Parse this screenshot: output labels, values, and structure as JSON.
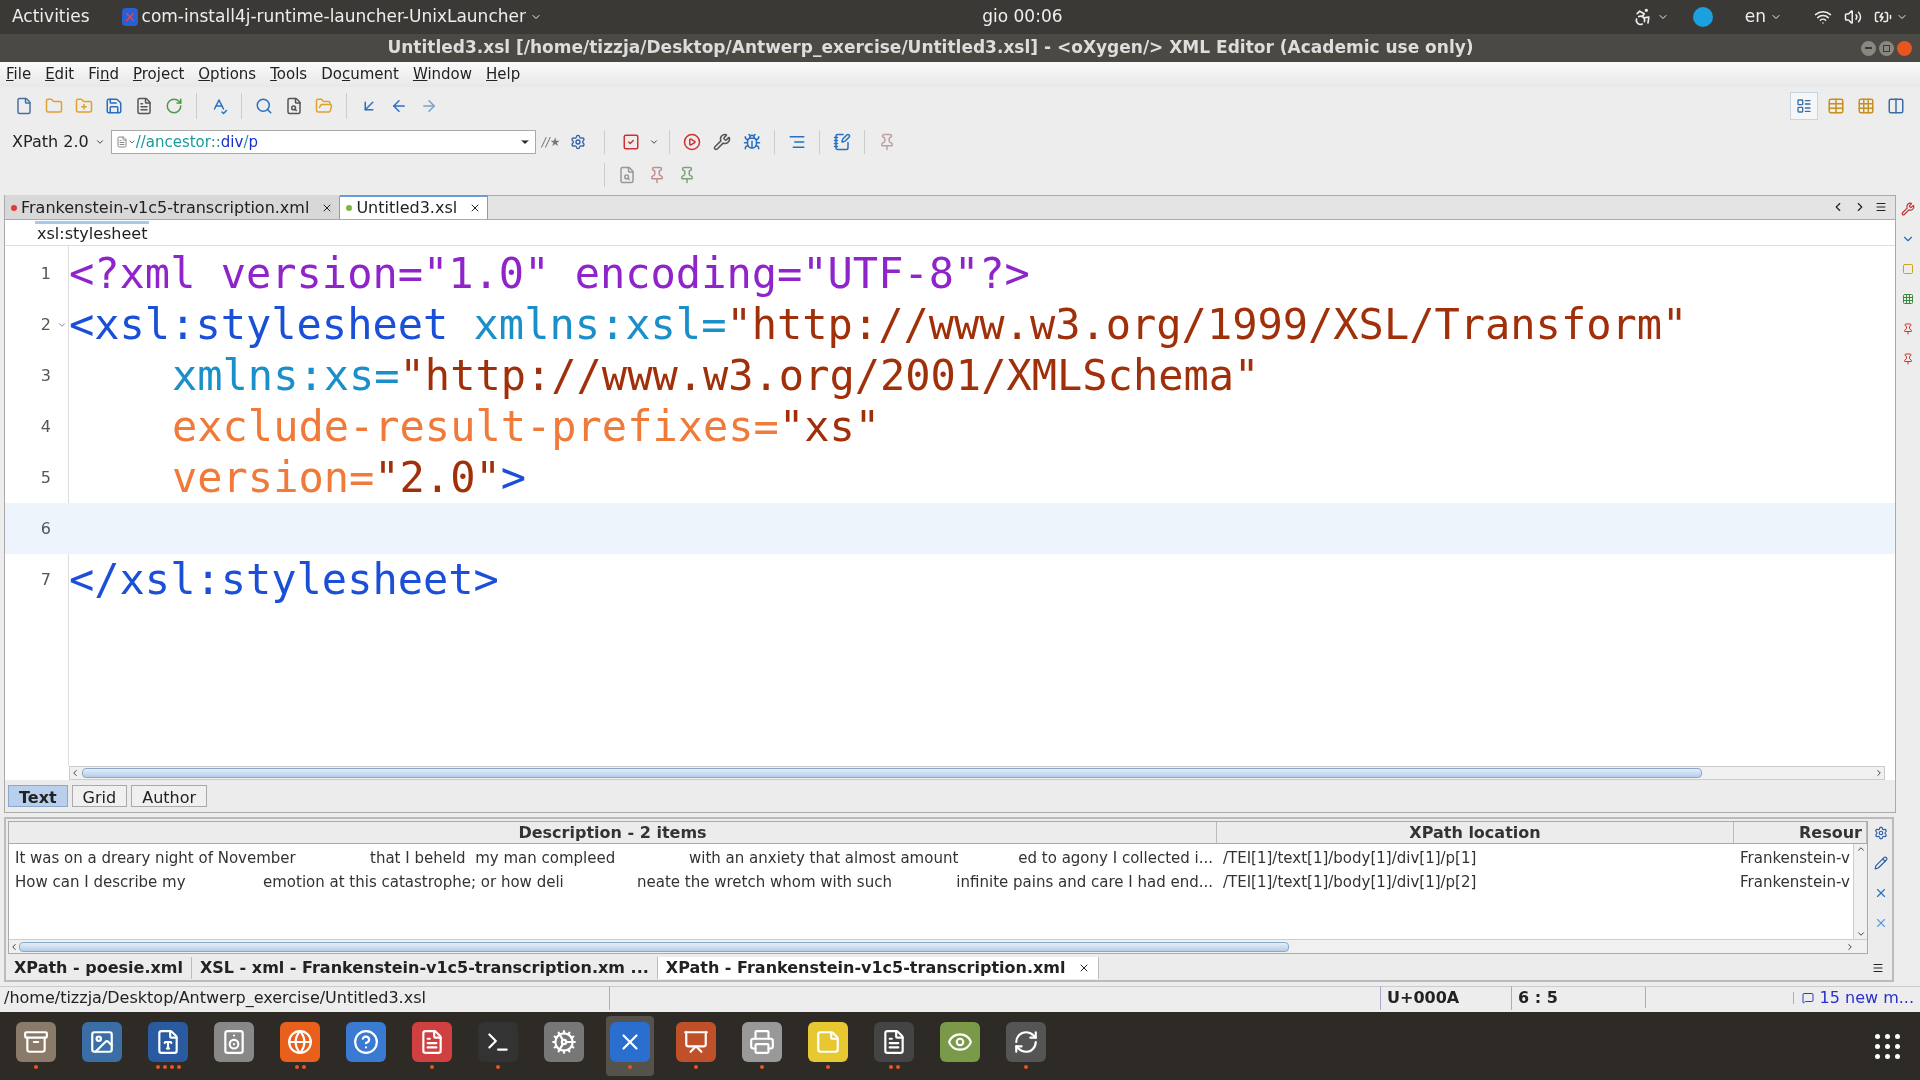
{
  "top_bar": {
    "activities": "Activities",
    "app_name": "com-install4j-runtime-launcher-UnixLauncher",
    "clock": "gio 00:06",
    "language": "en"
  },
  "window": {
    "title": "Untitled3.xsl [/home/tizzja/Desktop/Antwerp_exercise/Untitled3.xsl] - <oXygen/> XML Editor (Academic use only)"
  },
  "menu": [
    {
      "key": "F",
      "rest": "ile"
    },
    {
      "key": "E",
      "rest": "dit"
    },
    {
      "before": "Fi",
      "key": "n",
      "rest": "d"
    },
    {
      "key": "P",
      "rest": "roject"
    },
    {
      "key": "O",
      "rest": "ptions"
    },
    {
      "key": "T",
      "rest": "ools"
    },
    {
      "before": "Do",
      "key": "c",
      "rest": "ument"
    },
    {
      "key": "W",
      "rest": "indow"
    },
    {
      "key": "H",
      "rest": "elp"
    }
  ],
  "xpath_bar": {
    "version": "XPath 2.0",
    "regex_toggle": "//★",
    "query_parts": [
      {
        "text": "//ancestor::",
        "kind": "axis"
      },
      {
        "text": "div",
        "kind": "name"
      },
      {
        "text": "/",
        "kind": "axis"
      },
      {
        "text": "p",
        "kind": "name"
      }
    ]
  },
  "editor_tabs": [
    {
      "label": "Frankenstein-v1c5-transcription.xml",
      "color": "#e53935",
      "selected": false
    },
    {
      "label": "Untitled3.xsl",
      "color": "#7cb342",
      "selected": true
    }
  ],
  "breadcrumb": "xsl:stylesheet",
  "code_lines": [
    {
      "number": "1",
      "indent": false,
      "current": false,
      "foldable": false,
      "tokens": [
        {
          "text": "<?xml version=\"1.0\" encoding=\"UTF-8\"?>",
          "kind": "pi"
        }
      ]
    },
    {
      "number": "2",
      "indent": false,
      "current": false,
      "foldable": true,
      "tokens": [
        {
          "text": "<xsl:stylesheet ",
          "kind": "tag"
        },
        {
          "text": "xmlns:xsl=",
          "kind": "ns"
        },
        {
          "text": "\"http://www.w3.org/1999/XSL/Transform\"",
          "kind": "value"
        }
      ]
    },
    {
      "number": "3",
      "indent": true,
      "current": false,
      "foldable": false,
      "tokens": [
        {
          "text": "xmlns:xs=",
          "kind": "ns"
        },
        {
          "text": "\"http://www.w3.org/2001/XMLSchema\"",
          "kind": "value"
        }
      ]
    },
    {
      "number": "4",
      "indent": true,
      "current": false,
      "foldable": false,
      "tokens": [
        {
          "text": "exclude-result-prefixes=",
          "kind": "attr"
        },
        {
          "text": "\"xs\"",
          "kind": "value"
        }
      ]
    },
    {
      "number": "5",
      "indent": true,
      "current": false,
      "foldable": false,
      "tokens": [
        {
          "text": "version=",
          "kind": "attr"
        },
        {
          "text": "\"2.0\"",
          "kind": "value"
        },
        {
          "text": ">",
          "kind": "tag"
        }
      ]
    },
    {
      "number": "6",
      "current": true,
      "foldable": false
    },
    {
      "number": "7",
      "indent": false,
      "current": false,
      "foldable": false,
      "tokens": [
        {
          "text": "</xsl:stylesheet>",
          "kind": "tag"
        }
      ]
    }
  ],
  "mode_tabs": [
    {
      "label": "Text",
      "selected": true
    },
    {
      "label": "Grid",
      "selected": false
    },
    {
      "label": "Author",
      "selected": false
    }
  ],
  "results": {
    "columns": [
      "Description - 2 items",
      "XPath location",
      "Resour"
    ],
    "rows": [
      {
        "description_parts": [
          "It was on a dreary night of November",
          "that I beheld  my man compleed",
          "with an anxiety that almost amount",
          "ed to agony I collected i..."
        ],
        "location": "/TEI[1]/text[1]/body[1]/div[1]/p[1]",
        "resource": "Frankenstein-v"
      },
      {
        "description_parts": [
          "How can I describe my",
          "emotion at this catastrophe; or how deli",
          "neate the wretch whom with such",
          "infinite pains and care I had end..."
        ],
        "location": "/TEI[1]/text[1]/body[1]/div[1]/p[2]",
        "resource": "Frankenstein-v"
      }
    ]
  },
  "result_tabs": [
    {
      "label": "XPath - poesie.xml",
      "selected": false,
      "closable": false
    },
    {
      "label": "XSL - xml - Frankenstein-v1c5-transcription.xm ...",
      "selected": false,
      "closable": false
    },
    {
      "label": "XPath - Frankenstein-v1c5-transcription.xml",
      "selected": true,
      "closable": true
    }
  ],
  "status_bar": {
    "path": "/home/tizzja/Desktop/Antwerp_exercise/Untitled3.xsl",
    "char": "U+000A",
    "position": "6 : 5",
    "messages": "15 new m..."
  },
  "dock": [
    {
      "kind": "files",
      "running_windows": [
        {
          "kind": "dot"
        }
      ],
      "active": false
    },
    {
      "kind": "photos",
      "active": false
    },
    {
      "kind": "writer",
      "running_windows": [
        {
          "kind": "dot"
        },
        {
          "kind": "dot"
        },
        {
          "kind": "dot"
        },
        {
          "kind": "dot"
        }
      ],
      "active": false
    },
    {
      "kind": "speaker",
      "active": false
    },
    {
      "kind": "browser",
      "running_windows": [
        {
          "kind": "dot"
        },
        {
          "kind": "dot"
        }
      ],
      "active": false
    },
    {
      "kind": "help",
      "active": false
    },
    {
      "kind": "pdf",
      "running_windows": [
        {
          "kind": "dot"
        }
      ],
      "active": false
    },
    {
      "kind": "terminal",
      "running_windows": [
        {
          "kind": "dot"
        }
      ],
      "active": false
    },
    {
      "kind": "settings",
      "active": false
    },
    {
      "kind": "oxygen",
      "running_windows": [
        {
          "kind": "dot"
        }
      ],
      "active": true
    },
    {
      "kind": "impress",
      "running_windows": [
        {
          "kind": "dot"
        }
      ],
      "active": false
    },
    {
      "kind": "scanner",
      "running_windows": [
        {
          "kind": "dot"
        }
      ],
      "active": false
    },
    {
      "kind": "notes",
      "running_windows": [
        {
          "kind": "dot"
        }
      ],
      "active": false
    },
    {
      "kind": "sublime",
      "running_windows": [
        {
          "kind": "dot"
        },
        {
          "kind": "dot"
        }
      ],
      "active": false
    },
    {
      "kind": "viewer",
      "active": false
    },
    {
      "kind": "updater",
      "running_windows": [
        {
          "kind": "dot"
        }
      ],
      "active": false
    }
  ]
}
